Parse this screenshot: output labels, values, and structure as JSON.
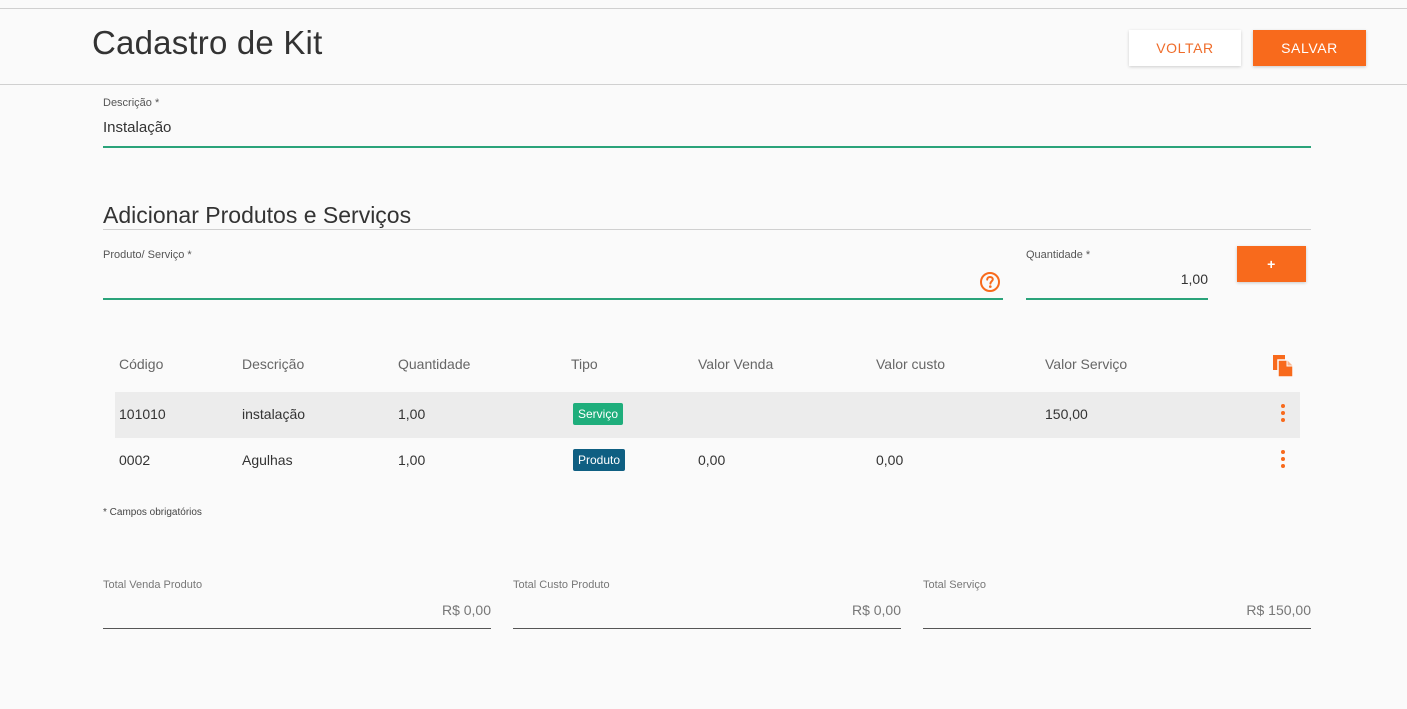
{
  "header": {
    "title": "Cadastro de Kit",
    "back_label": "VOLTAR",
    "save_label": "SALVAR"
  },
  "descricao": {
    "label": "Descrição *",
    "value": "Instalação"
  },
  "section": {
    "title": "Adicionar Produtos e Serviços"
  },
  "add_form": {
    "product_label": "Produto/ Serviço *",
    "product_value": "",
    "help_icon": "question-circle-icon",
    "quantity_label": "Quantidade *",
    "quantity_value": "1,00",
    "add_label": "+"
  },
  "table": {
    "columns": [
      "Código",
      "Descrição",
      "Quantidade",
      "Tipo",
      "Valor Venda",
      "Valor custo",
      "Valor Serviço"
    ],
    "copy_icon": "copy-icon",
    "rows": [
      {
        "codigo": "101010",
        "descricao": "instalação",
        "quantidade": "1,00",
        "tipo": "Serviço",
        "valor_venda": "",
        "valor_custo": "",
        "valor_servico": "150,00"
      },
      {
        "codigo": "0002",
        "descricao": "Agulhas",
        "quantidade": "1,00",
        "tipo": "Produto",
        "valor_venda": "0,00",
        "valor_custo": "0,00",
        "valor_servico": ""
      }
    ]
  },
  "footnote": "* Campos obrigatórios",
  "totals": {
    "venda_label": "Total Venda Produto",
    "venda_value": "R$ 0,00",
    "custo_label": "Total Custo Produto",
    "custo_value": "R$ 0,00",
    "servico_label": "Total Serviço",
    "servico_value": "R$ 150,00"
  },
  "colors": {
    "accent": "#f86a1c",
    "input_underline": "#2aa37a",
    "badge_servico": "#1fae7c",
    "badge_produto": "#0f5f82"
  }
}
